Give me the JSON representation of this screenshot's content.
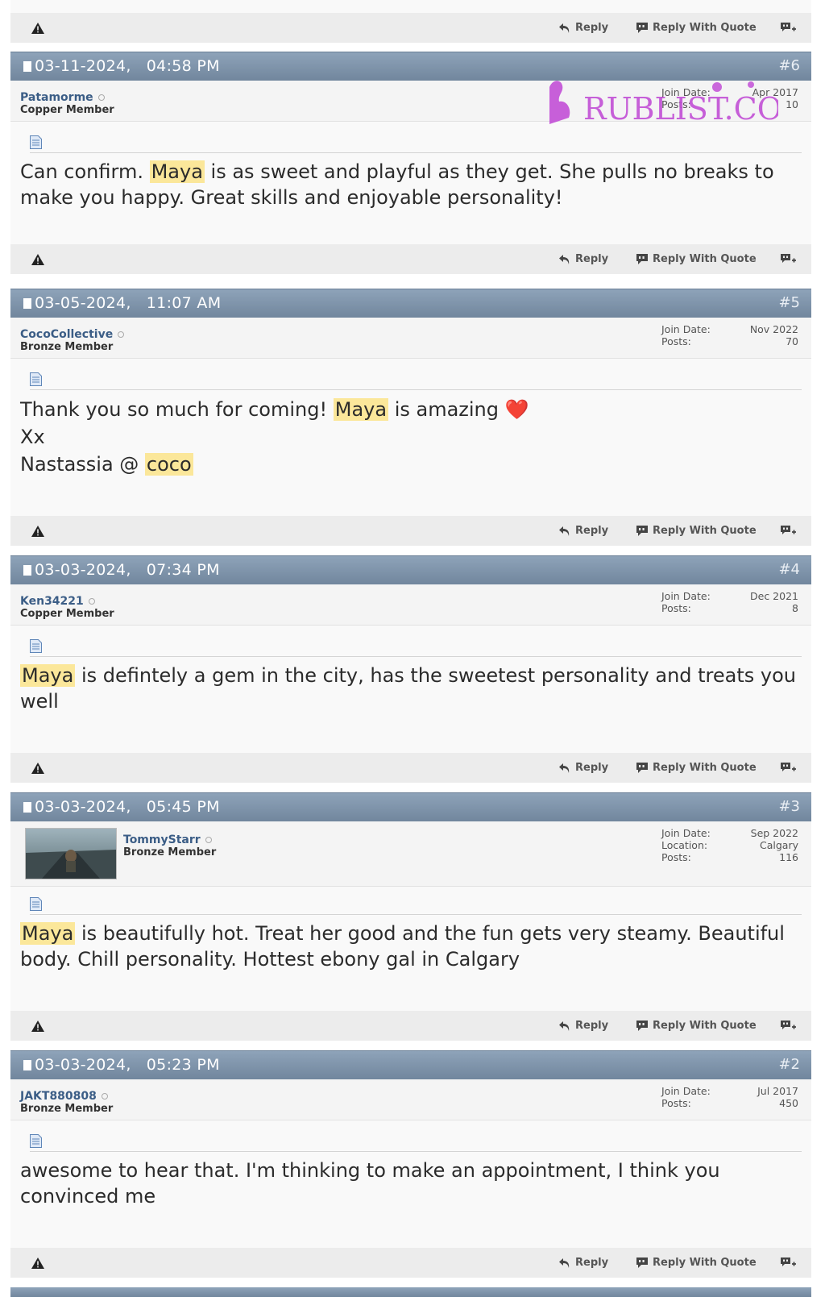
{
  "actions": {
    "reply": "Reply",
    "reply_quote": "Reply With Quote"
  },
  "watermark": {
    "text": "RUBLIST.COM",
    "color": "#c24fd6"
  },
  "colors": {
    "header": "#7f94aa",
    "username": "#3b5d86",
    "highlight": "#fbe79a",
    "action_bar": "#ececec"
  },
  "posts": [
    {
      "date": "03-11-2024,",
      "time": "04:58 PM",
      "number": "#6",
      "username": "Patamorme",
      "rank": "Copper Member",
      "join_label": "Join Date:",
      "join_value": "Apr 2017",
      "posts_label": "Posts:",
      "posts_value": "10",
      "text_a": "Can confirm. ",
      "hl_a": "Maya",
      "text_b": " is as sweet and playful as they get. She pulls no breaks to make you happy. Great skills and enjoyable personality!"
    },
    {
      "date": "03-05-2024,",
      "time": "11:07 AM",
      "number": "#5",
      "username": "CocoCollective",
      "rank": "Bronze Member",
      "join_label": "Join Date:",
      "join_value": "Nov 2022",
      "posts_label": "Posts:",
      "posts_value": "70",
      "line1_a": "Thank you so much for coming! ",
      "hl_a": "Maya",
      "line1_b": " is amazing",
      "heart": "❤️",
      "line2": "Xx",
      "line3_a": "Nastassia @ ",
      "hl_b": "coco"
    },
    {
      "date": "03-03-2024,",
      "time": "07:34 PM",
      "number": "#4",
      "username": "Ken34221",
      "rank": "Copper Member",
      "join_label": "Join Date:",
      "join_value": "Dec 2021",
      "posts_label": "Posts:",
      "posts_value": "8",
      "hl_a": "Maya",
      "text_b": " is defintely a gem in the city, has the sweetest personality and treats you well"
    },
    {
      "date": "03-03-2024,",
      "time": "05:45 PM",
      "number": "#3",
      "username": "TommyStarr",
      "rank": "Bronze Member",
      "join_label": "Join Date:",
      "join_value": "Sep 2022",
      "location_label": "Location:",
      "location_value": "Calgary",
      "posts_label": "Posts:",
      "posts_value": "116",
      "hl_a": "Maya",
      "text_b": " is beautifully hot. Treat her good and the fun gets very steamy. Beautiful body. Chill personality. Hottest ebony gal in Calgary"
    },
    {
      "date": "03-03-2024,",
      "time": "05:23 PM",
      "number": "#2",
      "username": "JAKT880808",
      "rank": "Bronze Member",
      "join_label": "Join Date:",
      "join_value": "Jul 2017",
      "posts_label": "Posts:",
      "posts_value": "450",
      "text_a": "awesome to hear that. I'm thinking to make an appointment, I think you convinced me"
    }
  ]
}
